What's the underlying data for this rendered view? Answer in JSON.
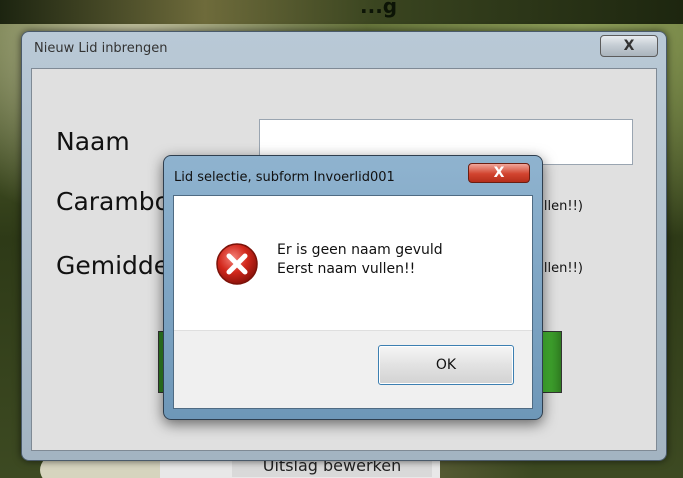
{
  "desktop": {
    "top_text": "...g",
    "behind_button_label": "Uitslag bewerken"
  },
  "main_window": {
    "title": "Nieuw Lid inbrengen",
    "close_label": "X",
    "fields": [
      {
        "label": "Naam",
        "value": ""
      },
      {
        "label": "Carambo",
        "hint": "vullen!!)"
      },
      {
        "label": "Gemidde",
        "hint": "vullen!!)"
      }
    ]
  },
  "dialog": {
    "title": "Lid selectie, subform Invoerlid001",
    "close_label": "X",
    "icon": "error-icon",
    "message_line1": "Er is geen naam gevuld",
    "message_line2": "Eerst naam vullen!!",
    "ok_label": "OK"
  },
  "colors": {
    "error_red": "#c8261c",
    "ok_border": "#3c7fb1"
  }
}
